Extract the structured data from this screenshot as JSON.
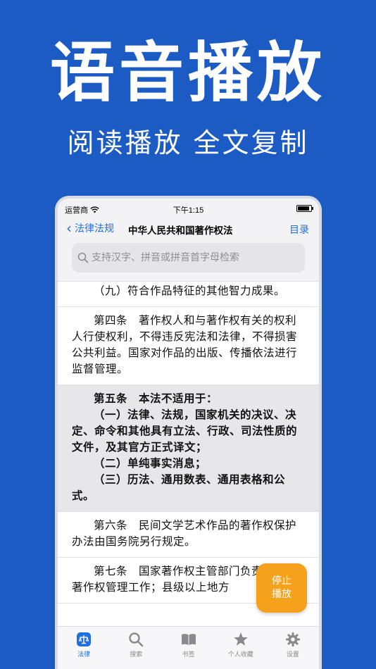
{
  "promo": {
    "title": "语音播放",
    "subtitle": "阅读播放 全文复制"
  },
  "status_bar": {
    "carrier": "运营商",
    "time": "下午1:15",
    "battery_level": 0.9
  },
  "nav": {
    "back_label": "法律法规",
    "title": "中华人民共和国著作权法",
    "toc_label": "目录"
  },
  "search": {
    "placeholder": "支持汉字、拼音或拼音首字母检索"
  },
  "articles": [
    {
      "paragraphs": [
        "（九）符合作品特征的其他智力成果。"
      ]
    },
    {
      "paragraphs": [
        "第四条　著作权人和与著作权有关的权利人行使权利，不得违反宪法和法律，不得损害公共利益。国家对作品的出版、传播依法进行监督管理。"
      ]
    },
    {
      "paragraphs": [
        "第五条　本法不适用于：",
        "（一）法律、法规，国家机关的决议、决定、命令和其他具有立法、行政、司法性质的文件，及其官方正式译文；",
        "（二）单纯事实消息；",
        "（三）历法、通用数表、通用表格和公式。"
      ]
    },
    {
      "paragraphs": [
        "第六条　民间文学艺术作品的著作权保护办法由国务院另行规定。"
      ]
    },
    {
      "paragraphs": [
        "第七条　国家著作权主管部门负责全国的著作权管理工作；县级以上地方"
      ]
    }
  ],
  "fab": {
    "line1": "停止",
    "line2": "播放"
  },
  "tabs": [
    {
      "label": "法律",
      "icon": "law-icon"
    },
    {
      "label": "搜索",
      "icon": "search-icon"
    },
    {
      "label": "书签",
      "icon": "book-icon"
    },
    {
      "label": "个人收藏",
      "icon": "star-icon"
    },
    {
      "label": "设置",
      "icon": "gear-icon"
    }
  ],
  "colors": {
    "background": "#1d5bc4",
    "accent": "#1f6fe0",
    "fab": "#f5a11c"
  }
}
